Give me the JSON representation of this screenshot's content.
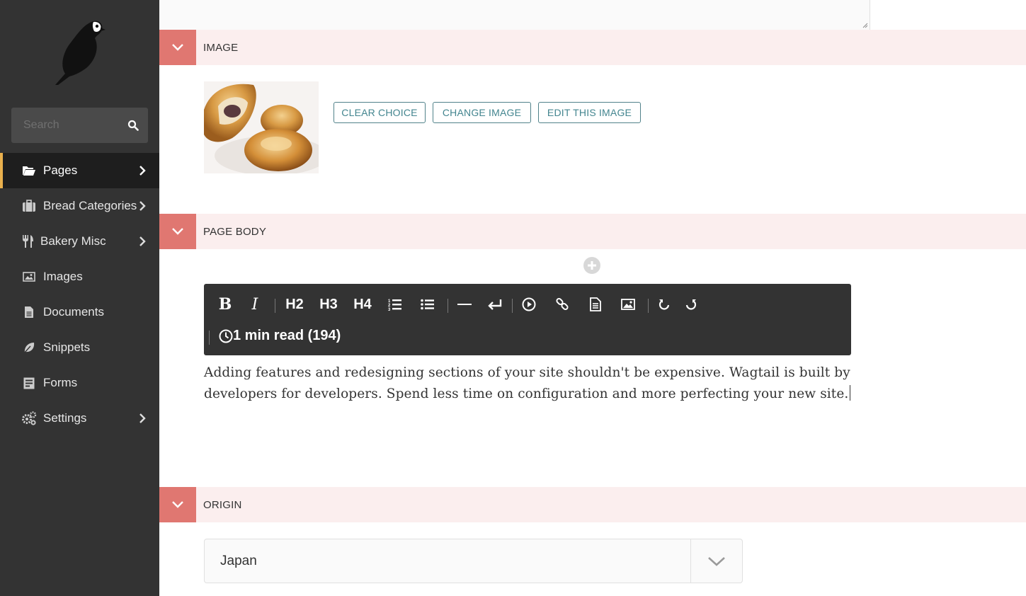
{
  "sidebar": {
    "search": {
      "placeholder": "Search"
    },
    "items": [
      {
        "label": "Pages",
        "icon": "folder-open-icon",
        "active": true,
        "has_submenu": true
      },
      {
        "label": "Bread Categories",
        "icon": "suitcase-icon",
        "active": false,
        "has_submenu": true
      },
      {
        "label": "Bakery Misc",
        "icon": "fork-knife-icon",
        "active": false,
        "has_submenu": true
      },
      {
        "label": "Images",
        "icon": "image-icon",
        "active": false,
        "has_submenu": false
      },
      {
        "label": "Documents",
        "icon": "document-icon",
        "active": false,
        "has_submenu": false
      },
      {
        "label": "Snippets",
        "icon": "leaf-icon",
        "active": false,
        "has_submenu": false
      },
      {
        "label": "Forms",
        "icon": "form-icon",
        "active": false,
        "has_submenu": false
      },
      {
        "label": "Settings",
        "icon": "cogs-icon",
        "active": false,
        "has_submenu": true
      }
    ]
  },
  "sections": {
    "image": {
      "title": "IMAGE",
      "buttons": {
        "clear": "CLEAR CHOICE",
        "change": "CHANGE IMAGE",
        "edit": "EDIT THIS IMAGE"
      }
    },
    "page_body": {
      "title": "PAGE BODY",
      "toolbar": {
        "bold": "B",
        "italic": "I",
        "h2": "H2",
        "h3": "H3",
        "h4": "H4",
        "read_time": "1 min read (194)"
      },
      "content": " Adding features and redesigning sections of your site shouldn't be expensive. Wagtail is built by developers for developers. Spend less time on configuration and more perfecting your new site."
    },
    "origin": {
      "title": "ORIGIN",
      "selected": "Japan"
    }
  },
  "colors": {
    "sidebar_bg": "#333333",
    "accent": "#e07771",
    "header_bg": "#fbeeee",
    "button_teal": "#43858f",
    "active_marker": "#e9b04d"
  }
}
